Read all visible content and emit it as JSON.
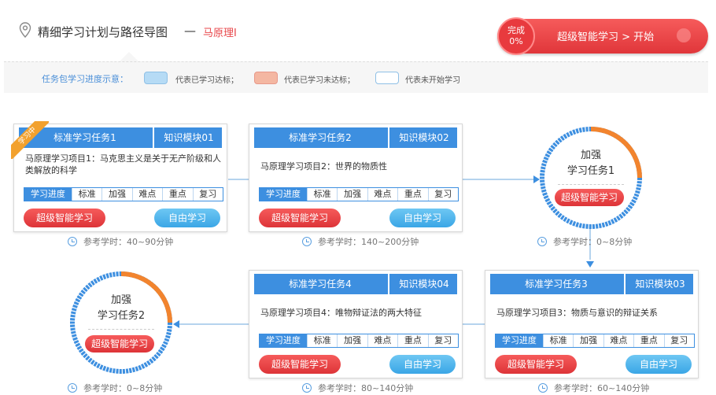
{
  "header": {
    "title": "精细学习计划与路径导图",
    "separator": "—",
    "course": "马原理I"
  },
  "progress": {
    "done_label": "完成",
    "percent": "0%",
    "action": "超级智能学习 > 开始"
  },
  "legend": {
    "title": "任务包学习进度示意：",
    "items": [
      {
        "label": "代表已学习达标；",
        "color": "#b6dbf5"
      },
      {
        "label": "代表已学习未达标；",
        "color": "#f4b7a2"
      },
      {
        "label": "代表未开始学习",
        "color": "#ffffff"
      }
    ]
  },
  "tabs": [
    "学习进度",
    "标准",
    "加强",
    "难点",
    "重点",
    "复习"
  ],
  "buttons": {
    "smart": "超级智能学习",
    "free": "自由学习"
  },
  "ref_prefix": "参考学时：",
  "tasks": [
    {
      "name": "标准学习任务1",
      "module": "知识模块01",
      "desc": "马原理学习项目1：马克思主义是关于无产阶级和人类解放的科学",
      "ref": "40~90分钟",
      "ribbon": "学习中"
    },
    {
      "name": "标准学习任务2",
      "module": "知识模块02",
      "desc": "马原理学习项目2：世界的物质性",
      "ref": "140~200分钟"
    },
    {
      "name": "标准学习任务3",
      "module": "知识模块03",
      "desc": "马原理学习项目3：物质与意识的辩证关系",
      "ref": "60~140分钟"
    },
    {
      "name": "标准学习任务4",
      "module": "知识模块04",
      "desc": "马原理学习项目4：唯物辩证法的两大特征",
      "ref": "80~140分钟"
    }
  ],
  "reinforce": [
    {
      "line1": "加强",
      "line2": "学习任务1",
      "button": "超级智能学习",
      "ref": "0~8分钟"
    },
    {
      "line1": "加强",
      "line2": "学习任务2",
      "button": "超级智能学习",
      "ref": "0~8分钟"
    }
  ],
  "colors": {
    "accent_blue": "#3d8fe0",
    "accent_red": "#e8464a",
    "ring_orange": "#f2842e"
  }
}
